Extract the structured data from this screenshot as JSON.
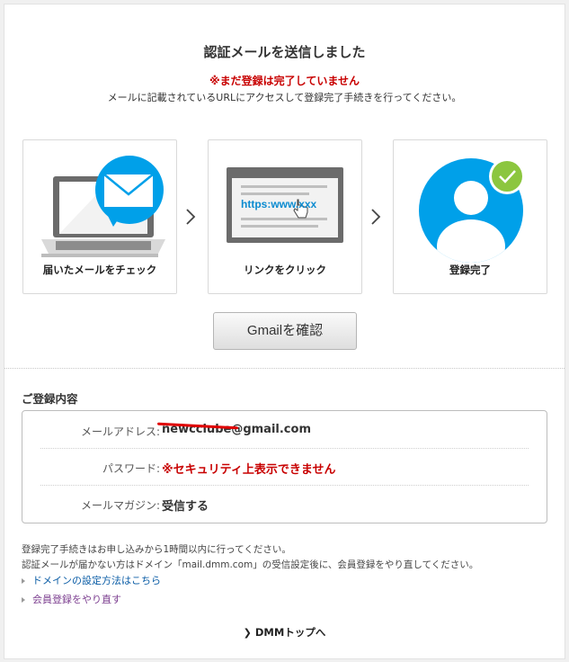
{
  "header": {
    "title": "認証メールを送信しました",
    "warning": "※まだ登録は完了していません",
    "description": "メールに記載されているURLにアクセスして登録完了手続きを行ってください。"
  },
  "steps": [
    {
      "label": "届いたメールをチェック",
      "icon": "laptop-mail-icon"
    },
    {
      "label": "リンクをクリック",
      "icon": "browser-link-icon",
      "url_text": "https:www.xxx"
    },
    {
      "label": "登録完了",
      "icon": "user-check-icon"
    }
  ],
  "gmail_button": "Gmailを確認",
  "registration": {
    "title": "ご登録内容",
    "rows": [
      {
        "key": "メールアドレス:",
        "value": "newcclube@gmail.com"
      },
      {
        "key": "パスワード:",
        "value": "※セキュリティ上表示できません"
      },
      {
        "key": "メールマガジン:",
        "value": "受信する"
      }
    ]
  },
  "notes": [
    "登録完了手続きはお申し込みから1時間以内に行ってください。",
    "認証メールが届かない方はドメイン「mail.dmm.com」の受信設定後に、会員登録をやり直してください。"
  ],
  "links": {
    "domain_settings": "ドメインの設定方法はこちら",
    "redo_registration": "会員登録をやり直す"
  },
  "footer": {
    "top_link": "DMMトップへ"
  },
  "colors": {
    "accent_blue": "#00a0e9",
    "warning_red": "#c80000",
    "check_green": "#8cc63f"
  }
}
